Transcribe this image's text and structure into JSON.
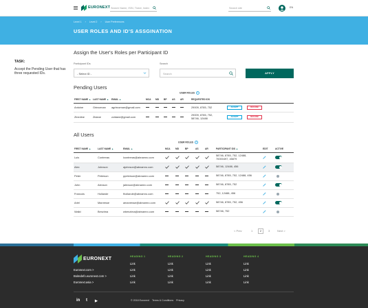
{
  "topnav": {
    "brand": "EURONEXT",
    "search_placeholder": "Search Name, ISIN, Ticker, Index",
    "search2_placeholder": "Search site",
    "lang": "EN"
  },
  "breadcrumb": [
    "Level 1",
    "Level 2",
    "User Preferences"
  ],
  "page_title": "USER ROLES AND ID'S ASSGINATION",
  "task": {
    "heading": "TASK:",
    "text": "Accept the Pending User that has three requested IDs."
  },
  "assign": {
    "title": "Assign the User's Roles per Participant ID",
    "participant_label": "Participant IDs",
    "select_value": "- Select ID -",
    "search_label": "Search",
    "search_placeholder": "Search",
    "apply_label": "APPLY"
  },
  "pending": {
    "title": "Pending Users",
    "roles_header": "USER ROLES",
    "columns": [
      "FIRST NAME",
      "LAST NAME",
      "EMAIL",
      "MCA",
      "MD",
      "BP",
      "AS",
      "AR",
      "REQUESTED IDS"
    ],
    "accept_label": "ACCEPT",
    "decline_label": "DECLINE",
    "rows": [
      {
        "first": "Antoine",
        "last": "Griezzman",
        "email": "agriezzman@gmail.com",
        "ids1": "29009, 8785, 752",
        "ids2": ""
      },
      {
        "first": "Zinedine",
        "last": "Zidane",
        "email": "zzidane@gmail.com",
        "ids1": "29009, 8785, 752,",
        "ids2": "58746, 12488"
      }
    ]
  },
  "all_users": {
    "title": "All Users",
    "roles_header": "USER ROLES",
    "columns": [
      "FIRST NAME",
      "LAST NAME",
      "EMAIL",
      "MCA",
      "MD",
      "BP",
      "AS",
      "AR",
      "PARTICIPANT IDS",
      "EDIT",
      "ACTIVE"
    ],
    "rows": [
      {
        "first": "Luis",
        "last": "Contreras",
        "email": "lcontreras@abnamro.com",
        "ids1": "58746, 8785, 752, 12488,",
        "ids2": "70000497, 45879",
        "roles": [
          1,
          1,
          1,
          1,
          1
        ],
        "active": true
      },
      {
        "first": "Alex",
        "last": "Johnson",
        "email": "ajohnson@abnamro.com",
        "ids1": "58746, 12488, 456",
        "ids2": "",
        "roles": [
          1,
          1,
          1,
          1,
          1
        ],
        "active": true
      },
      {
        "first": "Peter",
        "last": "Peterson",
        "email": "ppeterson@abnamro.com",
        "ids1": "58746, 8785, 752, 12488, 456",
        "ids2": "",
        "roles": [
          0,
          0,
          0,
          0,
          0
        ],
        "active": false
      },
      {
        "first": "John",
        "last": "Alexson",
        "email": "jalexson@abnamro.com",
        "ids1": "58746, 8785, 752",
        "ids2": "",
        "roles": [
          0,
          0,
          0,
          0,
          0
        ],
        "active": true
      },
      {
        "first": "Francois",
        "last": "Hollande",
        "email": "fhollande@abnamro.com",
        "ids1": "752, 12488, 456",
        "ids2": "",
        "roles": [
          0,
          0,
          0,
          0,
          0
        ],
        "active": false
      },
      {
        "first": "Ariel",
        "last": "Manresse",
        "email": "amanresse@abnamro.com",
        "ids1": "58746, 8785, 752, 456",
        "ids2": "",
        "roles": [
          1,
          1,
          1,
          1,
          1
        ],
        "active": true
      },
      {
        "first": "Walid",
        "last": "Benzima",
        "email": "wbenzima@abnamro.com",
        "ids1": "58746, 752",
        "ids2": "",
        "roles": [
          0,
          0,
          0,
          0,
          0
        ],
        "active": false
      }
    ]
  },
  "pager": {
    "prev": "< Prev",
    "p1": "1",
    "p2": "2",
    "p3": "3",
    "next": "Next >"
  },
  "footer": {
    "brand": "EURONEXT",
    "links": [
      "Euronext.com >",
      "Boitedefo.euronext.com >",
      "Euronext.asia >"
    ],
    "headings": [
      "HEADING 1",
      "HEADING 2",
      "HEADING 3",
      "HEADING 4"
    ],
    "link_label": "Link",
    "social": [
      "in",
      "t",
      "▶"
    ],
    "copyright": "© 2018 Euronext",
    "terms": "Terms & Conditions",
    "privacy": "Privacy"
  },
  "colors": {
    "accent": "#3fb0e3",
    "brand": "#00685e",
    "decline": "#e1334a",
    "footer_bg": "#2c2c2c",
    "footer_head": "#6bbf4a"
  }
}
